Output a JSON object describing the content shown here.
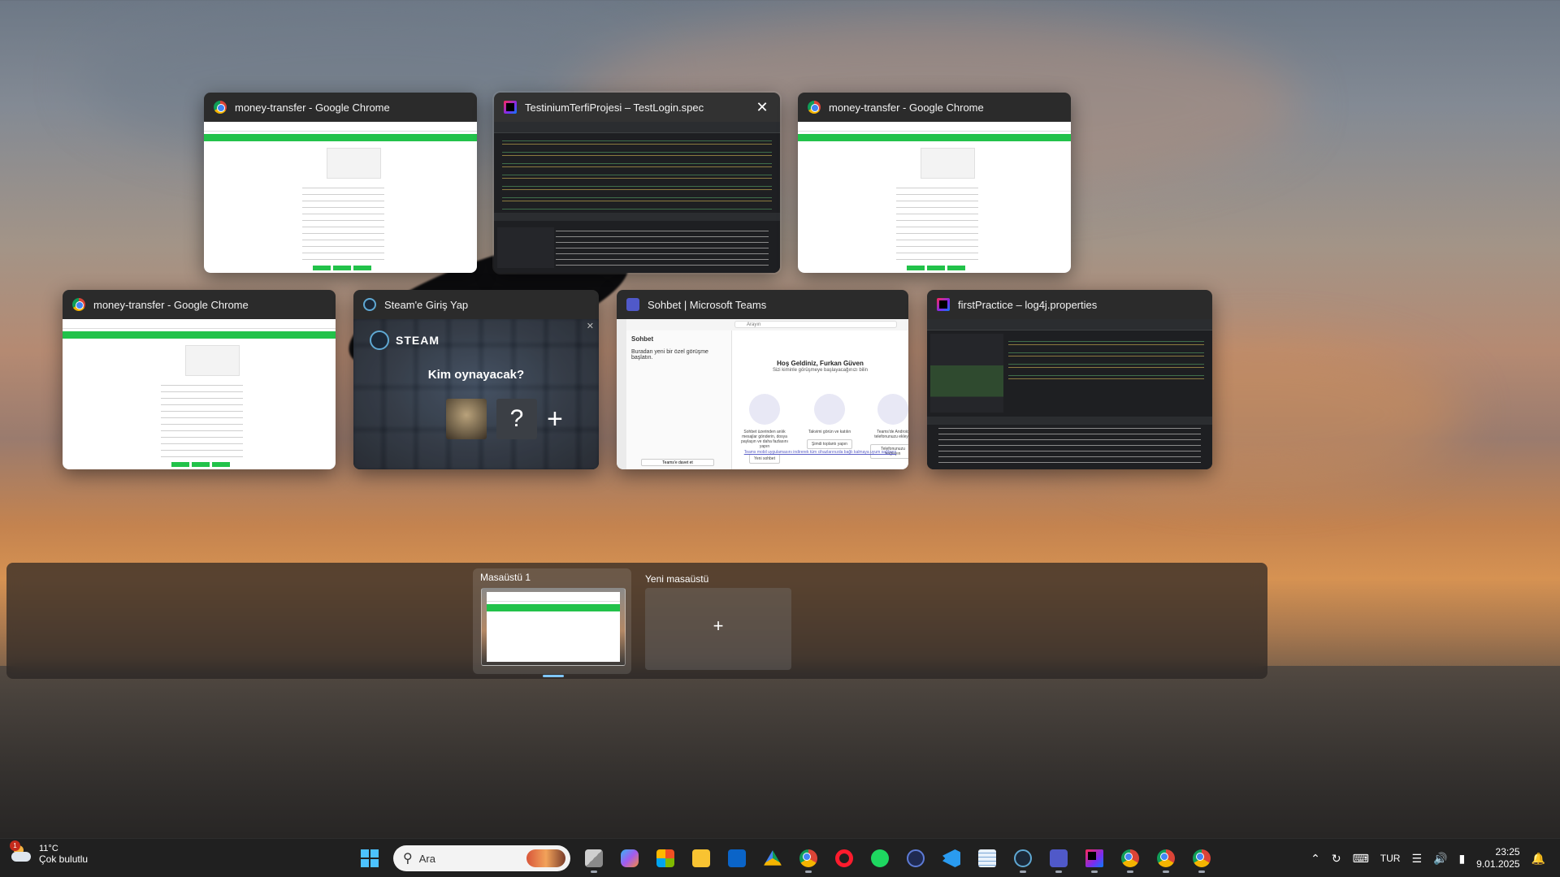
{
  "windows": [
    {
      "title": "money-transfer - Google Chrome",
      "icon": "chrome-icon"
    },
    {
      "title": "TestiniumTerfiProjesi – TestLogin.spec",
      "icon": "intellij-icon",
      "close": "✕"
    },
    {
      "title": "money-transfer - Google Chrome",
      "icon": "chrome-icon"
    },
    {
      "title": "money-transfer - Google Chrome",
      "icon": "chrome-icon"
    },
    {
      "title": "Steam'e Giriş Yap",
      "icon": "steam-icon"
    },
    {
      "title": "Sohbet | Microsoft Teams",
      "icon": "teams-icon"
    },
    {
      "title": "firstPractice – log4j.properties",
      "icon": "intellij-icon"
    }
  ],
  "steam": {
    "brand": "STEAM",
    "question": "Kim oynayacak?",
    "unknown": "?",
    "add": "+",
    "close": "✕"
  },
  "teams": {
    "sidebar_title": "Sohbet",
    "sidebar_hint": "Buradan yeni bir özel görüşme başlatın.",
    "search": "Arayın",
    "welcome": "Hoş Geldiniz, Furkan Güven",
    "welcome_sub": "Sizi kiminle görüşmeye başlayacağınızı bilin",
    "card1_text": "Sohbet üzerinden anlık mesajlar gönderin, dosya paylaşın ve daha fazlasını yapın",
    "card1_btn": "Yeni sohbet",
    "card2_text": "Takvimi görün ve katılın",
    "card2_btn": "Şimdi toplantı yapın",
    "card3_text": "Teams'de Android telefonunuzu ekleyin",
    "card3_btn": "Telefonunuzu bağlayın",
    "link": "Teams mobil uygulamasını indirerek tüm cihazlarınızda bağlı kalmaya uyum sağlayın",
    "invite": "Teams'e davet et"
  },
  "desktops": {
    "current": "Masaüstü 1",
    "new": "Yeni masaüstü",
    "new_plus": "+"
  },
  "taskbar": {
    "weather_temp": "11°C",
    "weather_desc": "Çok bulutlu",
    "weather_badge": "1",
    "search_placeholder": "Ara",
    "lang": "TUR",
    "time": "23:25",
    "date": "9.01.2025"
  }
}
